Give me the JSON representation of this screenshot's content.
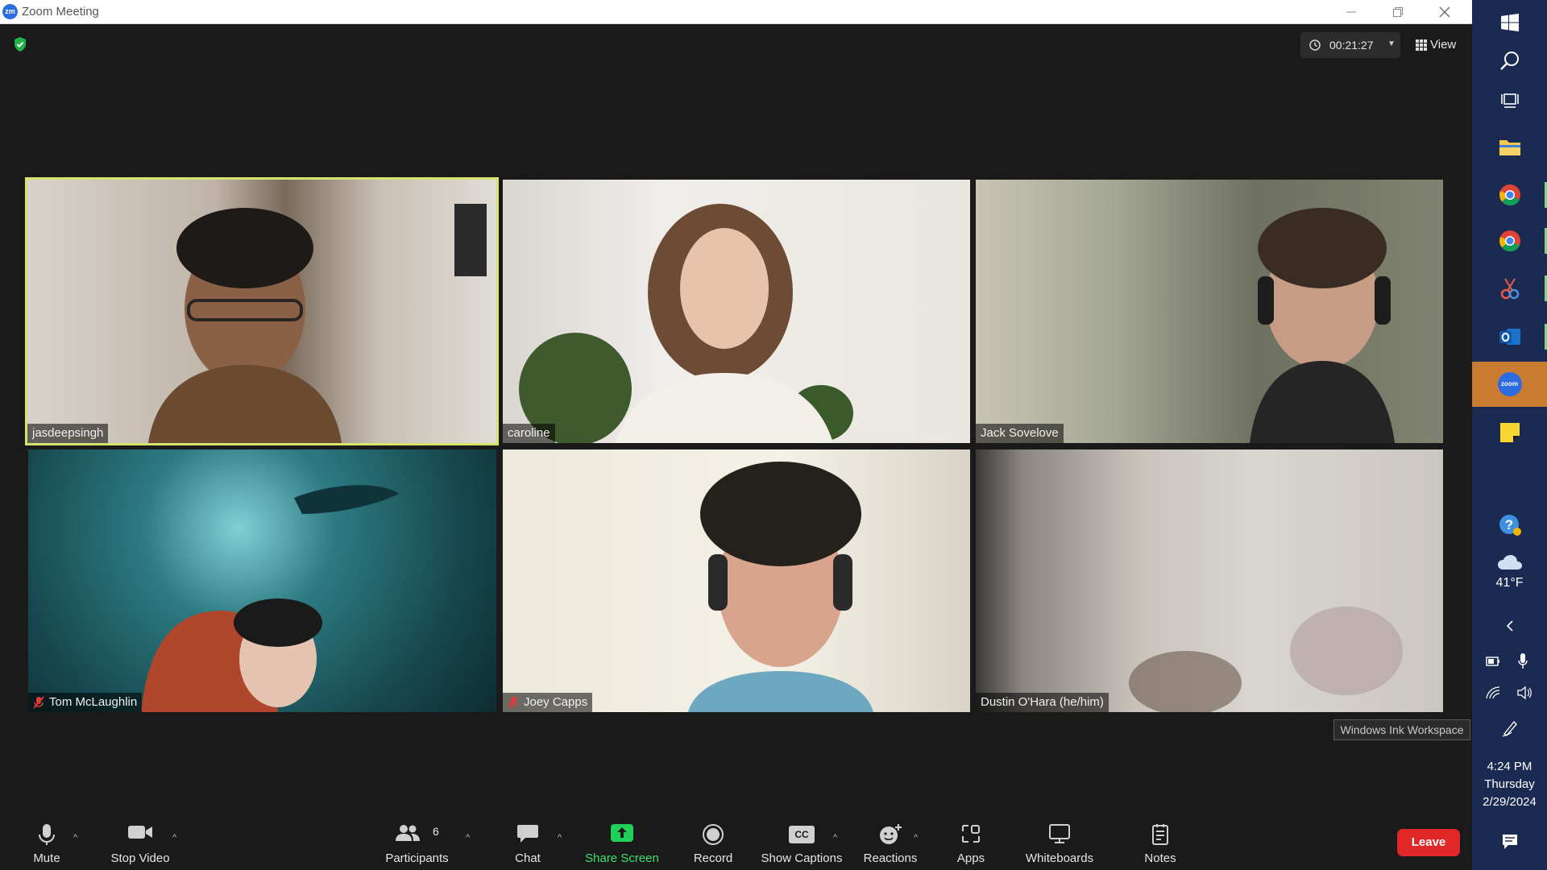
{
  "window": {
    "title": "Zoom Meeting",
    "logo_text": "zm"
  },
  "header": {
    "timer": "00:21:27",
    "view_label": "View"
  },
  "participants": [
    {
      "name": "jasdeepsingh",
      "muted": false,
      "active_speaker": true,
      "bg": "#c9b9a6"
    },
    {
      "name": "caroline",
      "muted": false,
      "active_speaker": false,
      "bg": "#e6e3df"
    },
    {
      "name": "Jack Sovelove",
      "muted": false,
      "active_speaker": false,
      "bg": "#8d8b7b"
    },
    {
      "name": "Tom McLaughlin",
      "muted": true,
      "active_speaker": false,
      "bg": "#1c4a52"
    },
    {
      "name": "Joey Capps",
      "muted": true,
      "active_speaker": false,
      "bg": "#d9d4c9"
    },
    {
      "name": "Dustin O'Hara (he/him)",
      "muted": false,
      "active_speaker": false,
      "bg": "#bdb6ae"
    }
  ],
  "tooltip": "Windows Ink Workspace",
  "toolbar": {
    "mute": "Mute",
    "stop_video": "Stop Video",
    "participants": "Participants",
    "participants_count": "6",
    "chat": "Chat",
    "share_screen": "Share Screen",
    "record": "Record",
    "show_captions": "Show Captions",
    "cc_glyph": "CC",
    "reactions": "Reactions",
    "apps": "Apps",
    "whiteboards": "Whiteboards",
    "notes": "Notes",
    "leave": "Leave"
  },
  "taskbar": {
    "weather_temp": "41°F",
    "time": "4:24 PM",
    "day": "Thursday",
    "date": "2/29/2024",
    "zoom_icon_text": "zoom"
  },
  "colors": {
    "accent_share": "#1fd15b",
    "leave": "#e02828",
    "active_speaker": "#d7e36a",
    "taskbar": "#1a2a50"
  }
}
